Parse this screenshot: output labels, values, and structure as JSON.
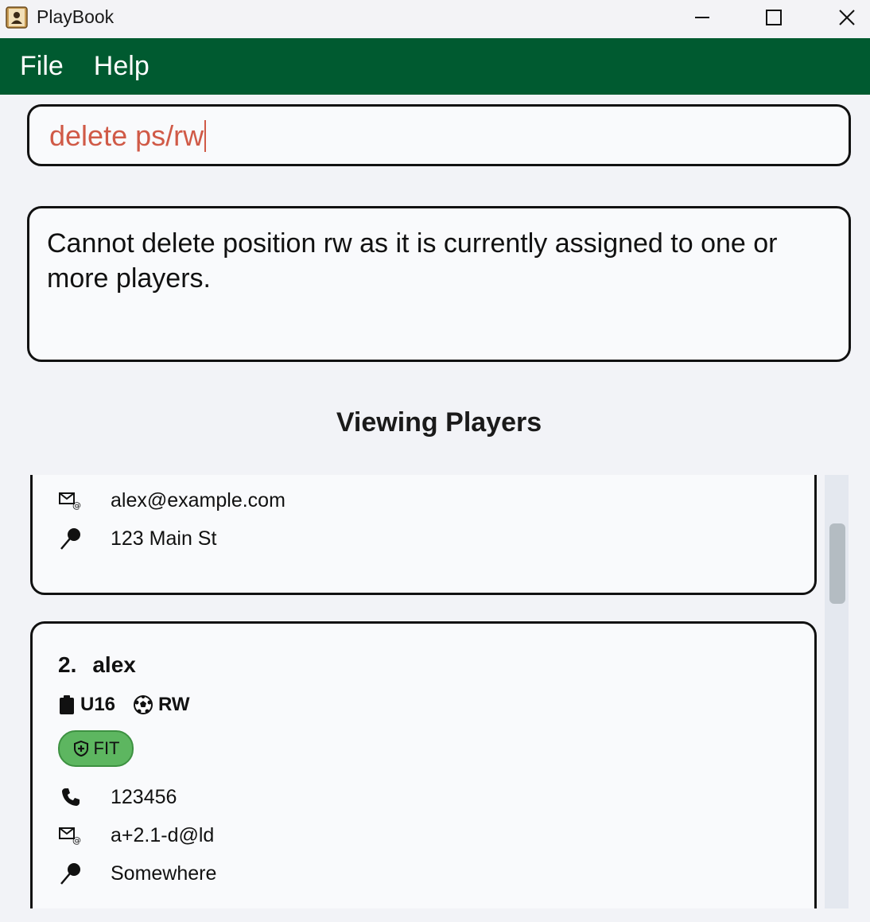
{
  "window": {
    "title": "PlayBook"
  },
  "menu": {
    "items": [
      "File",
      "Help"
    ]
  },
  "command": {
    "value": "delete ps/rw"
  },
  "result": {
    "message": "Cannot delete position rw as it is currently assigned to one or more players."
  },
  "list": {
    "heading": "Viewing Players",
    "players": [
      {
        "email": "alex@example.com",
        "address": "123 Main St"
      },
      {
        "index": "2.",
        "name": "alex",
        "team": "U16",
        "position": "RW",
        "status": "FIT",
        "phone": "123456",
        "email": "a+2.1-d@ld",
        "address": "Somewhere"
      }
    ]
  },
  "colors": {
    "menubar": "#005a30",
    "command_text": "#d05a47",
    "status_fit": "#5db660"
  }
}
